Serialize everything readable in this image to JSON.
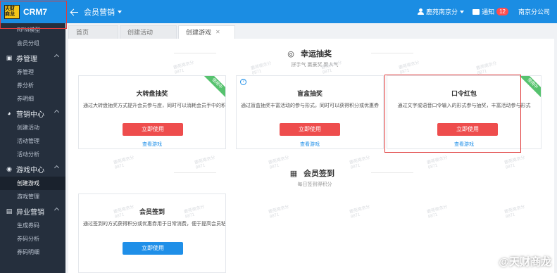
{
  "app": {
    "logo_badge": "天财商龙",
    "logo_name": "CRM7"
  },
  "sidebar": {
    "top_items": [
      "RFM模型",
      "会员分组"
    ],
    "groups": [
      {
        "label": "券管理",
        "icon": "coupon-icon",
        "items": [
          "券管理",
          "券分析",
          "券明细"
        ]
      },
      {
        "label": "营销中心",
        "icon": "pie-chart-icon",
        "items": [
          "创建活动",
          "活动管理",
          "活动分析"
        ]
      },
      {
        "label": "游戏中心",
        "icon": "gamepad-icon",
        "items": [
          "创建游戏",
          "游戏管理"
        ],
        "active": "创建游戏"
      },
      {
        "label": "异业营销",
        "icon": "shop-icon",
        "items": [
          "生成券码",
          "券码分析",
          "券码明细"
        ]
      }
    ]
  },
  "topbar": {
    "module": "会员营销",
    "user": "鹿苑南京分",
    "notice_label": "通知",
    "notice_count": "12",
    "company": "南京分公司"
  },
  "tabs": [
    {
      "label": "首页",
      "closable": false,
      "active": false
    },
    {
      "label": "创建活动",
      "closable": false,
      "active": false
    },
    {
      "label": "创建游戏",
      "closable": true,
      "active": true
    }
  ],
  "sections": {
    "lucky": {
      "title": "幸运抽奖",
      "subtitle": "拼手气 赢豪奖 聚人气",
      "icon": "target-icon"
    },
    "signin": {
      "title": "会员签到",
      "subtitle": "每日签到得积分",
      "icon": "calendar-check-icon"
    }
  },
  "cards": {
    "wheel": {
      "title": "大转盘抽奖",
      "desc": "通过大转盘抽奖方式提升会员参与度，同时可以消耗会员手中的积分",
      "button": "立即使用",
      "link": "查看游戏",
      "ribbon": "使用中"
    },
    "blindbox": {
      "title": "盲盒抽奖",
      "desc": "通过盲盒抽奖丰富活动的参与形式，同时可以获得积分或优惠券",
      "button": "立即使用",
      "link": "查看游戏"
    },
    "redpacket": {
      "title": "口令红包",
      "desc": "通过文字或语音口令输入的形式参与抽奖，丰富活动参与形式",
      "button": "立即使用",
      "link": "查看游戏",
      "ribbon": "使用中"
    },
    "signin": {
      "title": "会员签到",
      "desc": "通过签到的方式获得积分或优惠券用于日常消费，便于提高会员粘性",
      "button": "立即使用"
    }
  },
  "watermark": {
    "name": "鹿苑南京分",
    "code": "8871"
  },
  "corner_brand": "@天财商龙",
  "colors": {
    "primary": "#1b8de3",
    "danger": "#ee4d4d",
    "sidebar": "#252f3d",
    "ribbon": "#56c26e"
  }
}
